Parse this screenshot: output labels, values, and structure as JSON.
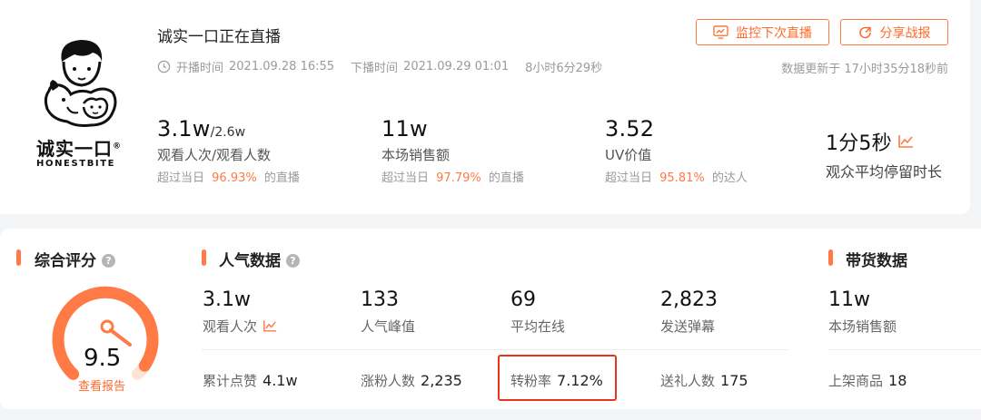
{
  "header": {
    "title": "诚实一口正在直播",
    "start_label": "开播时间",
    "start_time": "2021.09.28 16:55",
    "end_label": "下播时间",
    "end_time": "2021.09.29 01:01",
    "duration": "8小时6分29秒",
    "updated": "数据更新于 17小时35分18秒前",
    "monitor_button": "监控下次直播",
    "share_button": "分享战报"
  },
  "logo": {
    "name": "诚实一口",
    "sub": "HONESTBITE",
    "reg": "®"
  },
  "summary": [
    {
      "value": "3.1w",
      "value_suffix": "/2.6w",
      "label": "观看人次/观看人数",
      "prefix": "超过当日",
      "pct": "96.93%",
      "suffix": "的直播"
    },
    {
      "value": "11w",
      "value_suffix": "",
      "label": "本场销售额",
      "prefix": "超过当日",
      "pct": "97.79%",
      "suffix": "的直播"
    },
    {
      "value": "3.52",
      "value_suffix": "",
      "label": "UV价值",
      "prefix": "超过当日",
      "pct": "95.81%",
      "suffix": "的达人"
    }
  ],
  "avg_stay": {
    "value": "1分5秒",
    "label": "观众平均停留时长"
  },
  "score": {
    "title": "综合评分",
    "value": "9.5",
    "max": 10,
    "link": "查看报告"
  },
  "popularity": {
    "title": "人气数据",
    "stats": [
      {
        "value": "3.1w",
        "label": "观看人次"
      },
      {
        "value": "133",
        "label": "人气峰值"
      },
      {
        "value": "69",
        "label": "平均在线"
      },
      {
        "value": "2,823",
        "label": "发送弹幕"
      }
    ],
    "subrow": [
      {
        "label": "累计点赞",
        "value": "4.1w"
      },
      {
        "label": "涨粉人数",
        "value": "2,235"
      },
      {
        "label": "转粉率",
        "value": "7.12%"
      },
      {
        "label": "送礼人数",
        "value": "175"
      }
    ]
  },
  "sales": {
    "title": "带货数据",
    "value": "11w",
    "label": "本场销售额",
    "sub_label": "上架商品",
    "sub_value": "18"
  },
  "colors": {
    "accent": "#ff7a45",
    "highlight": "#e8341f"
  }
}
